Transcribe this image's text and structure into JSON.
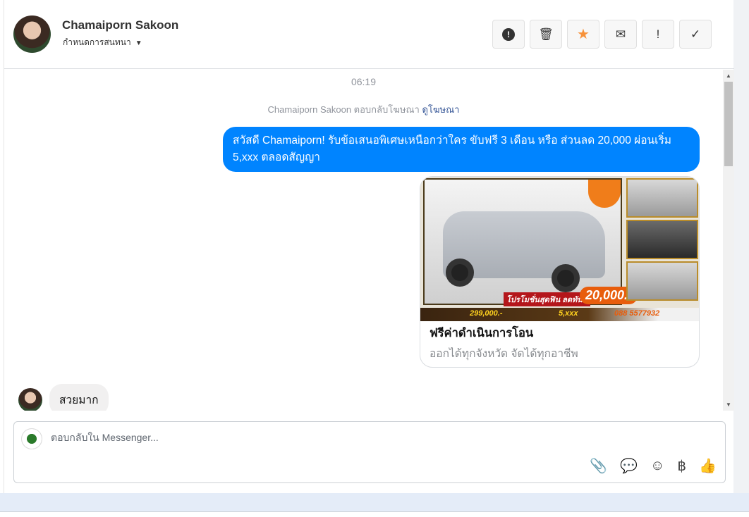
{
  "header": {
    "name": "Chamaiporn Sakoon",
    "assign_label": "กำหนดการสนทนา",
    "actions": [
      {
        "name": "report",
        "glyph": "⬤"
      },
      {
        "name": "delete",
        "glyph": "🗑"
      },
      {
        "name": "star",
        "glyph": "★"
      },
      {
        "name": "unread",
        "glyph": "✉"
      },
      {
        "name": "important",
        "glyph": "!"
      },
      {
        "name": "done",
        "glyph": "✓"
      }
    ]
  },
  "conversation": {
    "time": "06:19",
    "replied_text": "Chamaiporn Sakoon ตอบกลับโฆษณา",
    "view_ad_link": "ดูโฆษณา",
    "outgoing_message": "สวัสดี Chamaiporn! รับข้อเสนอพิเศษเหนือกว่าใคร ขับฟรี 3 เดือน หรือ ส่วนลด 20,000 ผ่อนเริ่ม 5,xxx ตลอดสัญญา",
    "ad": {
      "title": "ฟรีค่าดำเนินการโอน",
      "description": "ออกได้ทุกจังหวัด จัดได้ทุกอาชีพ",
      "image_promo": "โปรโมชั่นสุดฟิน ลดทันที",
      "image_price": "20,000.-",
      "image_price2": "299,000.-",
      "image_installment": "5,xxx",
      "image_phone": "088 5577932"
    },
    "incoming_message": "สวยมาก"
  },
  "composer": {
    "placeholder": "ตอบกลับใน Messenger...",
    "icons": [
      "📎",
      "💬",
      "☺",
      "฿",
      "👍"
    ]
  },
  "colors": {
    "accent": "#0084ff",
    "star": "#f7923a"
  }
}
